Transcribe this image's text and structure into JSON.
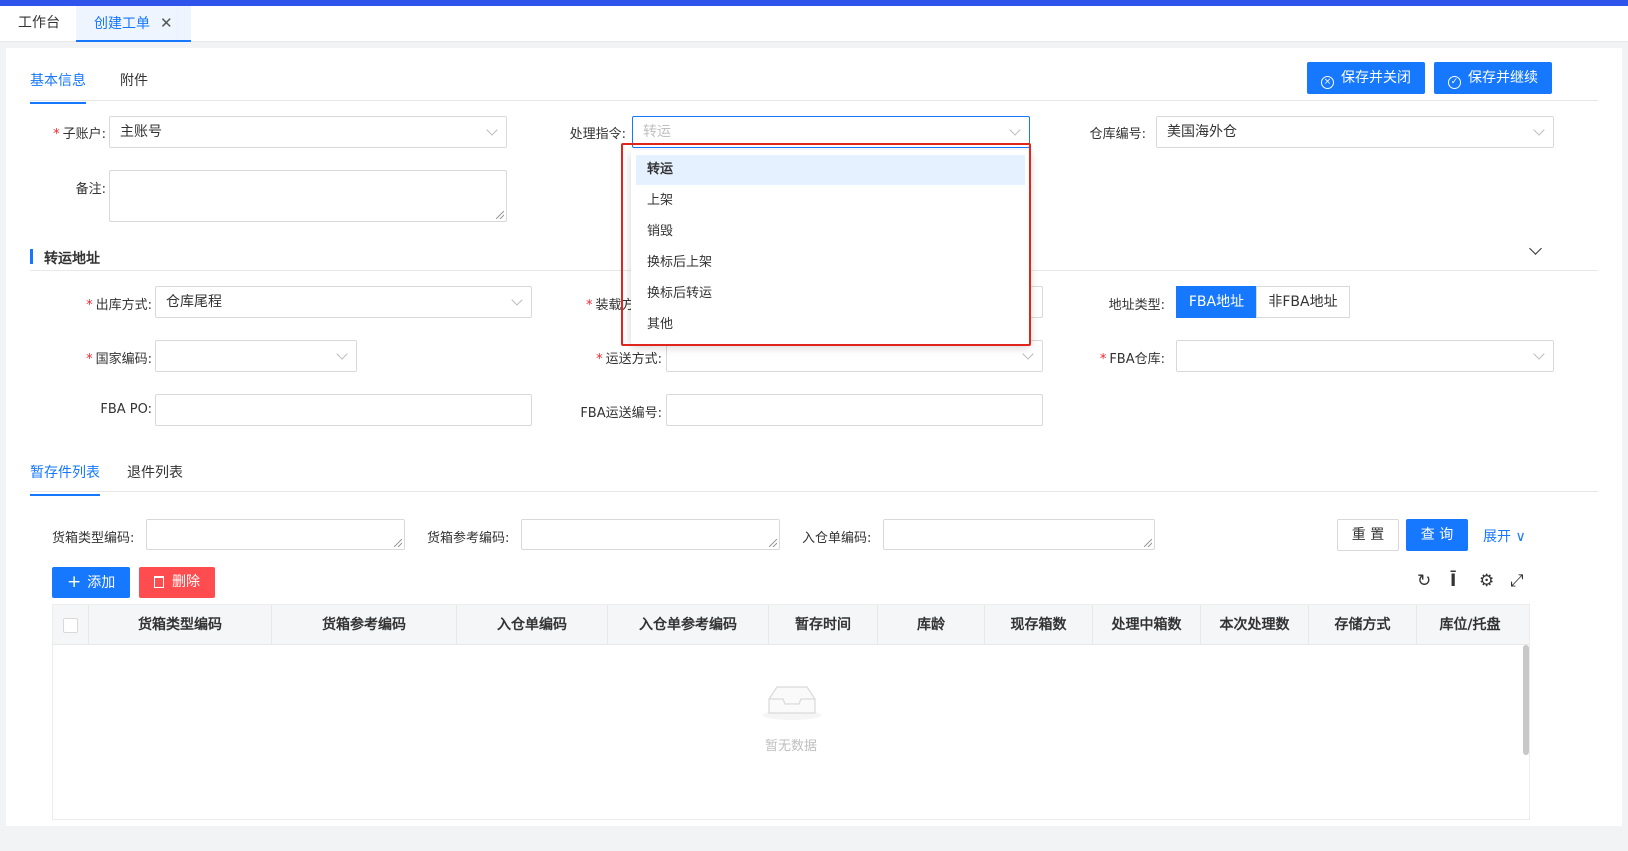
{
  "top_tabs": [
    {
      "label": "工作台"
    },
    {
      "label": "创建工单",
      "close": "✕"
    }
  ],
  "sub_tabs": [
    "基本信息",
    "附件"
  ],
  "actions": {
    "save_close": "保存并关闭",
    "save_continue": "保存并继续"
  },
  "form": {
    "sub_account": {
      "label": "子账户:",
      "value": "主账号"
    },
    "instruction": {
      "label": "处理指令:",
      "placeholder": "转运"
    },
    "warehouse_code": {
      "label": "仓库编号:",
      "value": "美国海外仓"
    },
    "remark": {
      "label": "备注:"
    }
  },
  "transfer_section": {
    "title": "转运地址",
    "outbound_method": {
      "label": "出库方式:",
      "value": "仓库尾程"
    },
    "loading_method": {
      "label": "装载方"
    },
    "address_type": {
      "label": "地址类型:",
      "options": [
        "FBA地址",
        "非FBA地址"
      ],
      "selected": "FBA地址"
    },
    "country_code": {
      "label": "国家编码:"
    },
    "shipping_method": {
      "label": "运送方式:"
    },
    "fba_warehouse": {
      "label": "FBA仓库:"
    },
    "fba_po": {
      "label": "FBA PO:"
    },
    "fba_shipment_no": {
      "label": "FBA运送编号:"
    }
  },
  "list_tabs": [
    "暂存件列表",
    "退件列表"
  ],
  "filters": {
    "box_type_code": "货箱类型编码:",
    "box_ref_code": "货箱参考编码:",
    "inbound_no": "入仓单编码:",
    "reset": "重 置",
    "query": "查 询",
    "expand": "展开 ∨"
  },
  "buttons": {
    "add": "添加",
    "delete": "删除"
  },
  "toolbar_icons": [
    "refresh-icon",
    "column-height-icon",
    "settings-icon",
    "fullscreen-icon"
  ],
  "table": {
    "columns": [
      "货箱类型编码",
      "货箱参考编码",
      "入仓单编码",
      "入仓单参考编码",
      "暂存时间",
      "库龄",
      "现存箱数",
      "处理中箱数",
      "本次处理数",
      "存储方式",
      "库位/托盘"
    ],
    "empty_text": "暂无数据"
  },
  "dropdown": {
    "options": [
      "转运",
      "上架",
      "销毁",
      "换标后上架",
      "换标后转运",
      "其他"
    ],
    "selected": "转运"
  },
  "colors": {
    "accent": "#1677ff",
    "danger": "#ff4d4f",
    "highlight": "#e0251d"
  }
}
